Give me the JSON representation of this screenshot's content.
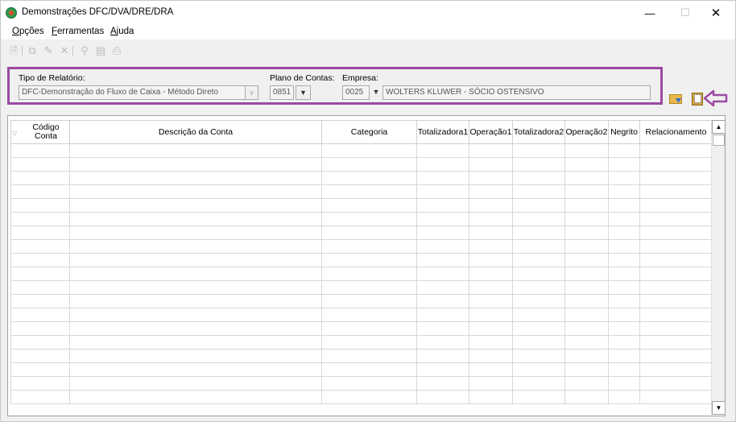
{
  "window": {
    "title": "Demonstrações DFC/DVA/DRE/DRA"
  },
  "menu": [
    {
      "label": "Opções",
      "underline": "O",
      "rest": "pções"
    },
    {
      "label": "Ferramentas",
      "underline": "F",
      "rest": "erramentas"
    },
    {
      "label": "Ajuda",
      "underline": "A",
      "rest": "juda"
    }
  ],
  "toolbar": {
    "icons": [
      "new-doc-icon",
      "copy-icon",
      "edit-icon",
      "delete-icon",
      "search-icon",
      "preview-icon",
      "print-icon"
    ]
  },
  "filters": {
    "tipo_label": "Tipo de Relatório:",
    "tipo_value": "DFC-Demonstração do Fluxo de Caixa - Método Direto",
    "plano_label": "Plano de Contas:",
    "plano_value": "0851",
    "empresa_label": "Empresa:",
    "empresa_code": "0025",
    "empresa_name": "WOLTERS KLUWER - SÓCIO OSTENSIVO"
  },
  "grid": {
    "columns": [
      "Código Conta",
      "Descrição da Conta",
      "Categoria",
      "Totalizadora1",
      "Operação1",
      "Totalizadora2",
      "Operação2",
      "Negrito",
      "Relacionamento"
    ],
    "row_count": 19
  },
  "colors": {
    "highlight": "#9b4aa3"
  }
}
